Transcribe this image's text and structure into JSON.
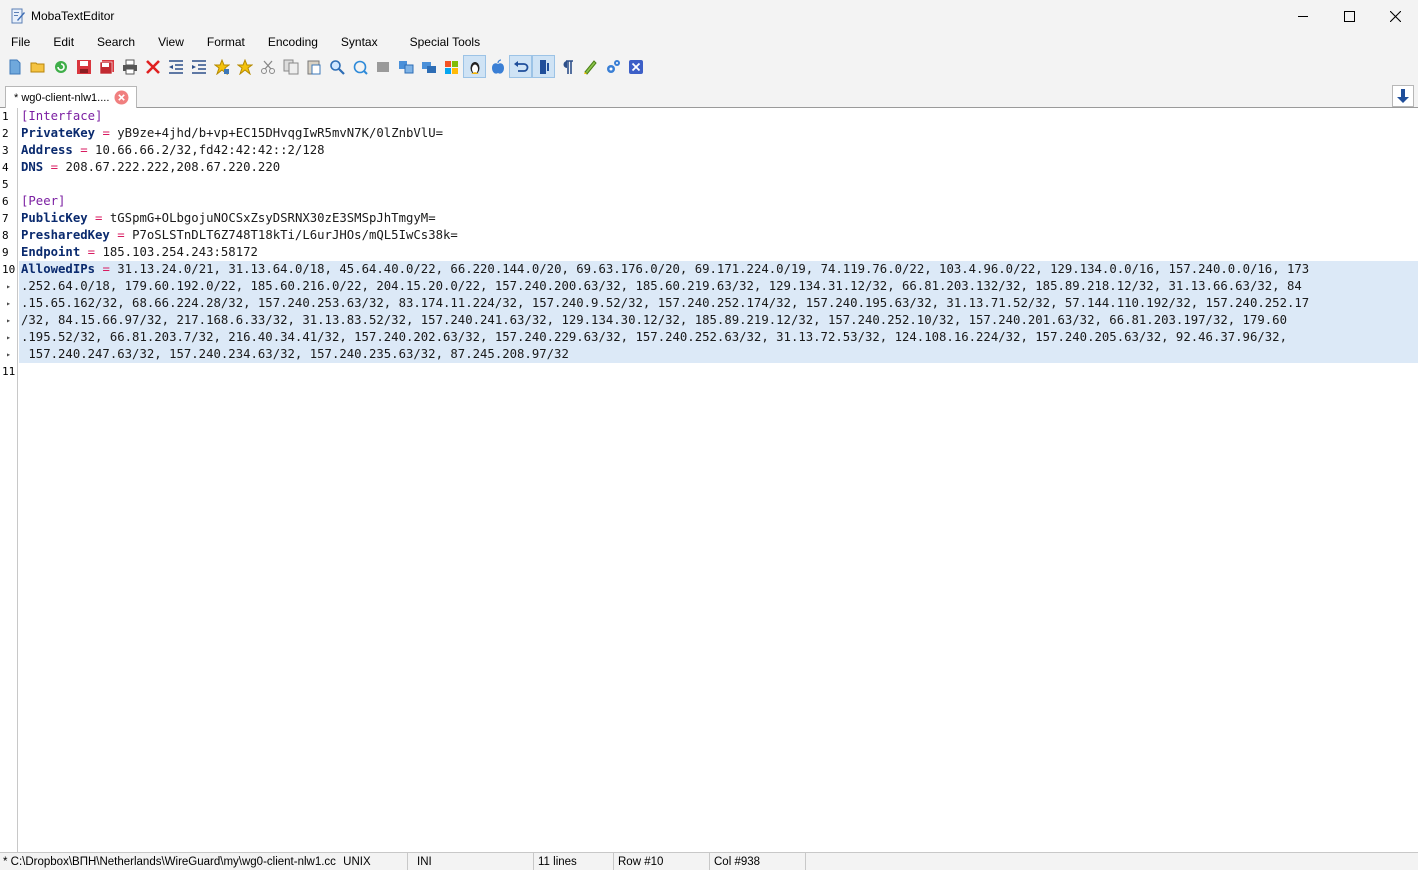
{
  "window": {
    "title": "MobaTextEditor"
  },
  "menu": [
    "File",
    "Edit",
    "Search",
    "View",
    "Format",
    "Encoding",
    "Syntax",
    "Special Tools"
  ],
  "toolbar": {
    "icons": [
      "new-file-icon",
      "open-folder-icon",
      "reload-icon",
      "save-icon",
      "save-all-icon",
      "print-icon",
      "close-file-icon",
      "unindent-icon",
      "indent-icon",
      "add-bookmark-icon",
      "bookmark-icon",
      "cut-icon",
      "copy-icon",
      "paste-icon",
      "find-icon",
      "replace-icon",
      "select-all-icon",
      "compare-icon",
      "sync-icon",
      "windows-eol-icon",
      "linux-eol-icon",
      "mac-eol-icon",
      "undo-icon",
      "word-wrap-icon",
      "pilcrow-icon",
      "highlight-icon",
      "settings-icon",
      "exit-icon"
    ],
    "active": [
      "linux-eol-icon",
      "undo-icon",
      "word-wrap-icon"
    ]
  },
  "tab": {
    "label": "* wg0-client-nlw1...."
  },
  "editor": {
    "line_numbers": [
      "1",
      "2",
      "3",
      "4",
      "5",
      "6",
      "7",
      "8",
      "9",
      "10",
      "▸",
      "▸",
      "▸",
      "▸",
      "▸",
      "11"
    ],
    "lines": [
      {
        "section": "[Interface]"
      },
      {
        "key": "PrivateKey",
        "op": " = ",
        "value": "yB9ze+4jhd/b+vp+EC15DHvqgIwR5mvN7K/0lZnbVlU="
      },
      {
        "key": "Address",
        "op": " = ",
        "value": "10.66.66.2/32,fd42:42:42::2/128"
      },
      {
        "key": "DNS",
        "op": " = ",
        "value": "208.67.222.222,208.67.220.220"
      },
      {},
      {
        "section": "[Peer]"
      },
      {
        "key": "PublicKey",
        "op": " = ",
        "value": "tGSpmG+OLbgojuNOCSxZsyDSRNX30zE3SMSpJhTmgyM="
      },
      {
        "key": "PresharedKey",
        "op": " = ",
        "value": "P7oSLSTnDLT6Z748T18kTi/L6urJHOs/mQL5IwCs38k="
      },
      {
        "key": "Endpoint",
        "op": " = ",
        "value": "185.103.254.243:58172"
      },
      {
        "key": "AllowedIPs",
        "op": " = ",
        "value": "31.13.24.0/21, 31.13.64.0/18, 45.64.40.0/22, 66.220.144.0/20, 69.63.176.0/20, 69.171.224.0/19, 74.119.76.0/22, 103.4.96.0/22, 129.134.0.0/16, 157.240.0.0/16, 173",
        "highlight": true
      },
      {
        "value": ".252.64.0/18, 179.60.192.0/22, 185.60.216.0/22, 204.15.20.0/22, 157.240.200.63/32, 185.60.219.63/32, 129.134.31.12/32, 66.81.203.132/32, 185.89.218.12/32, 31.13.66.63/32, 84",
        "highlight": true
      },
      {
        "value": ".15.65.162/32, 68.66.224.28/32, 157.240.253.63/32, 83.174.11.224/32, 157.240.9.52/32, 157.240.252.174/32, 157.240.195.63/32, 31.13.71.52/32, 57.144.110.192/32, 157.240.252.17",
        "highlight": true
      },
      {
        "value": "/32, 84.15.66.97/32, 217.168.6.33/32, 31.13.83.52/32, 157.240.241.63/32, 129.134.30.12/32, 185.89.219.12/32, 157.240.252.10/32, 157.240.201.63/32, 66.81.203.197/32, 179.60",
        "highlight": true
      },
      {
        "value": ".195.52/32, 66.81.203.7/32, 216.40.34.41/32, 157.240.202.63/32, 157.240.229.63/32, 157.240.252.63/32, 31.13.72.53/32, 124.108.16.224/32, 157.240.205.63/32, 92.46.37.96/32,",
        "highlight": true
      },
      {
        "value": " 157.240.247.63/32, 157.240.234.63/32, 157.240.235.63/32, 87.245.208.97/32",
        "highlight": true
      },
      {}
    ]
  },
  "status": {
    "path": "* C:\\Dropbox\\ВПН\\Netherlands\\WireGuard\\my\\wg0-client-nlw1.cc",
    "eol": "UNIX",
    "syntax": "INI",
    "lines": "11 lines",
    "row": "Row #10",
    "col": "Col #938"
  }
}
